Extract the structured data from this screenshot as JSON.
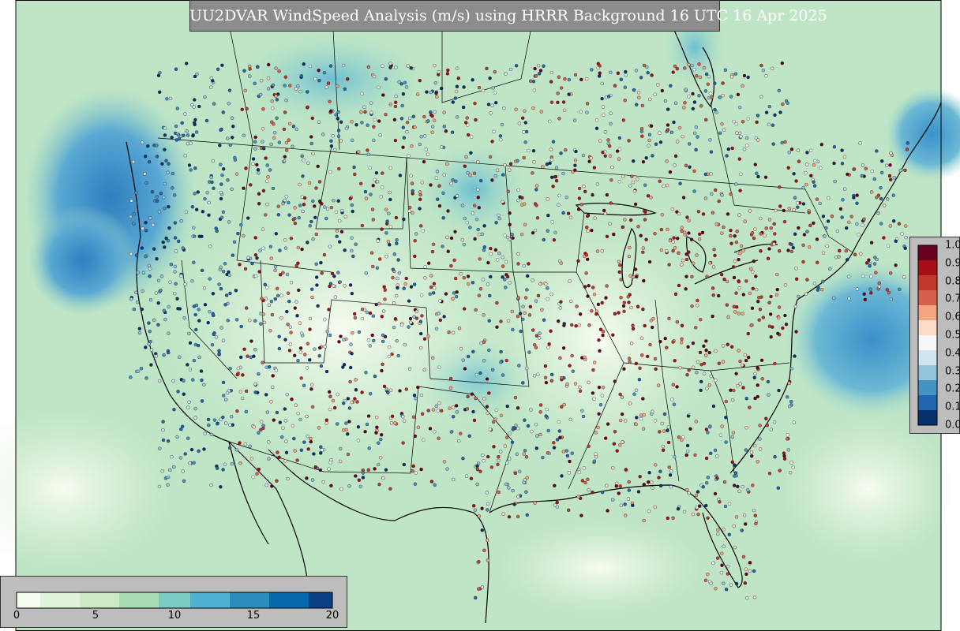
{
  "title": "UU2DVAR WindSpeed Analysis (m/s) using HRRR Background 16 UTC 16 Apr 2025",
  "colors": {
    "ocean_blue": "#3f8fc8",
    "land_pale": "#e9f6e2",
    "land_mint": "#c6e8c4",
    "mid_teal": "#86c9c2",
    "coast_line": "#000000",
    "panel_gray": "#bdbdbd",
    "title_gray": "#8c8c8c",
    "title_text": "#ffffff",
    "obs_low": "#08306b",
    "obs_mid": "#f7f7f7",
    "obs_high": "#67001f"
  },
  "obs_legend": {
    "ticks": [
      "1.0",
      "0.9",
      "0.8",
      "0.7",
      "0.6",
      "0.5",
      "0.4",
      "0.3",
      "0.2",
      "0.1",
      "0.0"
    ],
    "colors": [
      "#67001f",
      "#a50f15",
      "#c0392b",
      "#d6604d",
      "#f4a582",
      "#fddbc7",
      "#f7f7f7",
      "#d1e5f0",
      "#92c5de",
      "#4393c3",
      "#2166ac",
      "#08306b"
    ]
  },
  "wind_legend": {
    "ticks": [
      "0",
      "5",
      "10",
      "15",
      "20"
    ],
    "min": 0,
    "max": 20,
    "colors": [
      "#f7fcf0",
      "#e0f3db",
      "#ccebc5",
      "#a8ddb5",
      "#7bccc4",
      "#4eb3d3",
      "#2b8cbe",
      "#0868ac",
      "#084081"
    ]
  }
}
